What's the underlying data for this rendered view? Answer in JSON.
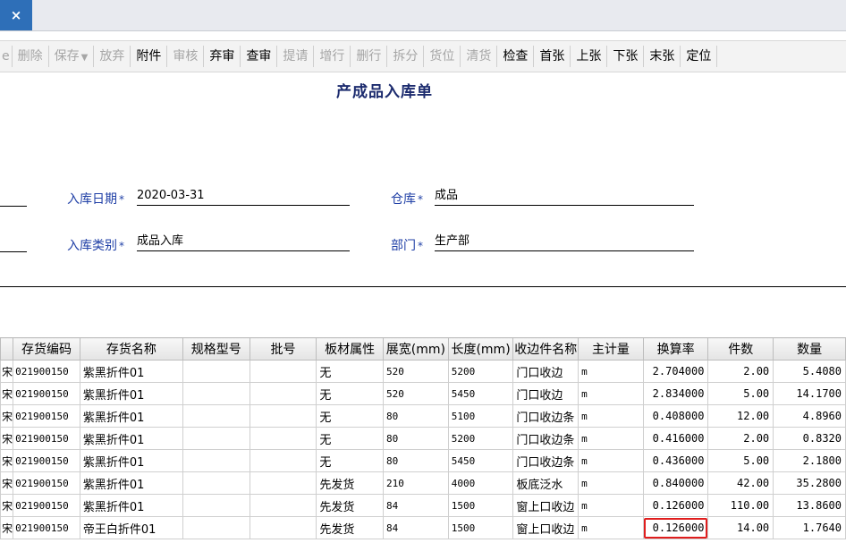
{
  "window": {
    "close_glyph": "×"
  },
  "toolbar": {
    "lead": "e",
    "buttons": [
      {
        "label": "删除",
        "enabled": false
      },
      {
        "label": "保存",
        "enabled": false,
        "dropdown": true
      },
      {
        "label": "放弃",
        "enabled": false
      },
      {
        "label": "附件",
        "enabled": true
      },
      {
        "label": "审核",
        "enabled": false
      },
      {
        "label": "弃审",
        "enabled": true
      },
      {
        "label": "查审",
        "enabled": true
      },
      {
        "label": "提请",
        "enabled": false
      },
      {
        "label": "增行",
        "enabled": false
      },
      {
        "label": "删行",
        "enabled": false
      },
      {
        "label": "拆分",
        "enabled": false
      },
      {
        "label": "货位",
        "enabled": false
      },
      {
        "label": "清货",
        "enabled": false
      },
      {
        "label": "检查",
        "enabled": true
      },
      {
        "label": "首张",
        "enabled": true
      },
      {
        "label": "上张",
        "enabled": true
      },
      {
        "label": "下张",
        "enabled": true
      },
      {
        "label": "末张",
        "enabled": true
      },
      {
        "label": "定位",
        "enabled": true
      }
    ]
  },
  "form": {
    "title": "产成品入库单",
    "required_mark": "*",
    "inbound_date_label": "入库日期",
    "inbound_date_value": "2020-03-31",
    "warehouse_label": "仓库",
    "warehouse_value": "成品",
    "inbound_type_label": "入库类别",
    "inbound_type_value": "成品入库",
    "department_label": "部门",
    "department_value": "生产部"
  },
  "grid": {
    "columns": [
      "存货编码",
      "存货名称",
      "规格型号",
      "批号",
      "板材属性",
      "展宽(mm)",
      "长度(mm)",
      "收边件名称",
      "主计量",
      "换算率",
      "件数",
      "数量"
    ],
    "rows": [
      {
        "stub": "宋",
        "code": "021900150",
        "name": "紫黑折件01",
        "spec": "",
        "batch": "",
        "attr": "无",
        "width": "520",
        "length": "5200",
        "part": "门口收边",
        "unit": "m",
        "rate": "2.704000",
        "pieces": "2.00",
        "qty": "5.4080"
      },
      {
        "stub": "宋",
        "code": "021900150",
        "name": "紫黑折件01",
        "spec": "",
        "batch": "",
        "attr": "无",
        "width": "520",
        "length": "5450",
        "part": "门口收边",
        "unit": "m",
        "rate": "2.834000",
        "pieces": "5.00",
        "qty": "14.1700"
      },
      {
        "stub": "宋",
        "code": "021900150",
        "name": "紫黑折件01",
        "spec": "",
        "batch": "",
        "attr": "无",
        "width": "80",
        "length": "5100",
        "part": "门口收边条",
        "unit": "m",
        "rate": "0.408000",
        "pieces": "12.00",
        "qty": "4.8960"
      },
      {
        "stub": "宋",
        "code": "021900150",
        "name": "紫黑折件01",
        "spec": "",
        "batch": "",
        "attr": "无",
        "width": "80",
        "length": "5200",
        "part": "门口收边条",
        "unit": "m",
        "rate": "0.416000",
        "pieces": "2.00",
        "qty": "0.8320"
      },
      {
        "stub": "宋",
        "code": "021900150",
        "name": "紫黑折件01",
        "spec": "",
        "batch": "",
        "attr": "无",
        "width": "80",
        "length": "5450",
        "part": "门口收边条",
        "unit": "m",
        "rate": "0.436000",
        "pieces": "5.00",
        "qty": "2.1800"
      },
      {
        "stub": "宋",
        "code": "021900150",
        "name": "紫黑折件01",
        "spec": "",
        "batch": "",
        "attr": "先发货",
        "width": "210",
        "length": "4000",
        "part": "板底泛水",
        "unit": "m",
        "rate": "0.840000",
        "pieces": "42.00",
        "qty": "35.2800"
      },
      {
        "stub": "宋",
        "code": "021900150",
        "name": "紫黑折件01",
        "spec": "",
        "batch": "",
        "attr": "先发货",
        "width": "84",
        "length": "1500",
        "part": "窗上口收边",
        "unit": "m",
        "rate": "0.126000",
        "pieces": "110.00",
        "qty": "13.8600"
      },
      {
        "stub": "宋",
        "code": "021900150",
        "name": "帝王白折件01",
        "spec": "",
        "batch": "",
        "attr": "先发货",
        "width": "84",
        "length": "1500",
        "part": "窗上口收边",
        "unit": "m",
        "rate": "0.126000",
        "pieces": "14.00",
        "qty": "1.7640"
      }
    ]
  }
}
